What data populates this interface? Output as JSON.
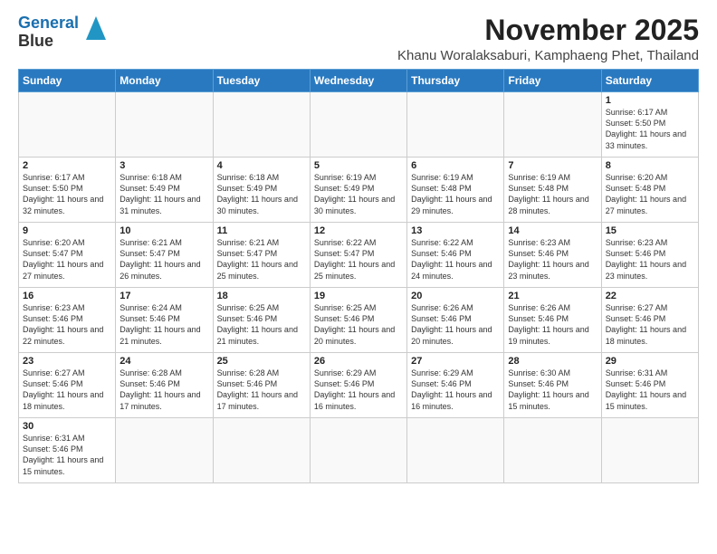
{
  "logo": {
    "line1": "General",
    "line2": "Blue"
  },
  "title": "November 2025",
  "location": "Khanu Woralaksaburi, Kamphaeng Phet, Thailand",
  "days_of_week": [
    "Sunday",
    "Monday",
    "Tuesday",
    "Wednesday",
    "Thursday",
    "Friday",
    "Saturday"
  ],
  "weeks": [
    [
      {
        "day": "",
        "info": ""
      },
      {
        "day": "",
        "info": ""
      },
      {
        "day": "",
        "info": ""
      },
      {
        "day": "",
        "info": ""
      },
      {
        "day": "",
        "info": ""
      },
      {
        "day": "",
        "info": ""
      },
      {
        "day": "1",
        "info": "Sunrise: 6:17 AM\nSunset: 5:50 PM\nDaylight: 11 hours\nand 33 minutes."
      }
    ],
    [
      {
        "day": "2",
        "info": "Sunrise: 6:17 AM\nSunset: 5:50 PM\nDaylight: 11 hours\nand 32 minutes."
      },
      {
        "day": "3",
        "info": "Sunrise: 6:18 AM\nSunset: 5:49 PM\nDaylight: 11 hours\nand 31 minutes."
      },
      {
        "day": "4",
        "info": "Sunrise: 6:18 AM\nSunset: 5:49 PM\nDaylight: 11 hours\nand 30 minutes."
      },
      {
        "day": "5",
        "info": "Sunrise: 6:19 AM\nSunset: 5:49 PM\nDaylight: 11 hours\nand 30 minutes."
      },
      {
        "day": "6",
        "info": "Sunrise: 6:19 AM\nSunset: 5:48 PM\nDaylight: 11 hours\nand 29 minutes."
      },
      {
        "day": "7",
        "info": "Sunrise: 6:19 AM\nSunset: 5:48 PM\nDaylight: 11 hours\nand 28 minutes."
      },
      {
        "day": "8",
        "info": "Sunrise: 6:20 AM\nSunset: 5:48 PM\nDaylight: 11 hours\nand 27 minutes."
      }
    ],
    [
      {
        "day": "9",
        "info": "Sunrise: 6:20 AM\nSunset: 5:47 PM\nDaylight: 11 hours\nand 27 minutes."
      },
      {
        "day": "10",
        "info": "Sunrise: 6:21 AM\nSunset: 5:47 PM\nDaylight: 11 hours\nand 26 minutes."
      },
      {
        "day": "11",
        "info": "Sunrise: 6:21 AM\nSunset: 5:47 PM\nDaylight: 11 hours\nand 25 minutes."
      },
      {
        "day": "12",
        "info": "Sunrise: 6:22 AM\nSunset: 5:47 PM\nDaylight: 11 hours\nand 25 minutes."
      },
      {
        "day": "13",
        "info": "Sunrise: 6:22 AM\nSunset: 5:46 PM\nDaylight: 11 hours\nand 24 minutes."
      },
      {
        "day": "14",
        "info": "Sunrise: 6:23 AM\nSunset: 5:46 PM\nDaylight: 11 hours\nand 23 minutes."
      },
      {
        "day": "15",
        "info": "Sunrise: 6:23 AM\nSunset: 5:46 PM\nDaylight: 11 hours\nand 23 minutes."
      }
    ],
    [
      {
        "day": "16",
        "info": "Sunrise: 6:23 AM\nSunset: 5:46 PM\nDaylight: 11 hours\nand 22 minutes."
      },
      {
        "day": "17",
        "info": "Sunrise: 6:24 AM\nSunset: 5:46 PM\nDaylight: 11 hours\nand 21 minutes."
      },
      {
        "day": "18",
        "info": "Sunrise: 6:25 AM\nSunset: 5:46 PM\nDaylight: 11 hours\nand 21 minutes."
      },
      {
        "day": "19",
        "info": "Sunrise: 6:25 AM\nSunset: 5:46 PM\nDaylight: 11 hours\nand 20 minutes."
      },
      {
        "day": "20",
        "info": "Sunrise: 6:26 AM\nSunset: 5:46 PM\nDaylight: 11 hours\nand 20 minutes."
      },
      {
        "day": "21",
        "info": "Sunrise: 6:26 AM\nSunset: 5:46 PM\nDaylight: 11 hours\nand 19 minutes."
      },
      {
        "day": "22",
        "info": "Sunrise: 6:27 AM\nSunset: 5:46 PM\nDaylight: 11 hours\nand 18 minutes."
      }
    ],
    [
      {
        "day": "23",
        "info": "Sunrise: 6:27 AM\nSunset: 5:46 PM\nDaylight: 11 hours\nand 18 minutes."
      },
      {
        "day": "24",
        "info": "Sunrise: 6:28 AM\nSunset: 5:46 PM\nDaylight: 11 hours\nand 17 minutes."
      },
      {
        "day": "25",
        "info": "Sunrise: 6:28 AM\nSunset: 5:46 PM\nDaylight: 11 hours\nand 17 minutes."
      },
      {
        "day": "26",
        "info": "Sunrise: 6:29 AM\nSunset: 5:46 PM\nDaylight: 11 hours\nand 16 minutes."
      },
      {
        "day": "27",
        "info": "Sunrise: 6:29 AM\nSunset: 5:46 PM\nDaylight: 11 hours\nand 16 minutes."
      },
      {
        "day": "28",
        "info": "Sunrise: 6:30 AM\nSunset: 5:46 PM\nDaylight: 11 hours\nand 15 minutes."
      },
      {
        "day": "29",
        "info": "Sunrise: 6:31 AM\nSunset: 5:46 PM\nDaylight: 11 hours\nand 15 minutes."
      }
    ],
    [
      {
        "day": "30",
        "info": "Sunrise: 6:31 AM\nSunset: 5:46 PM\nDaylight: 11 hours\nand 15 minutes."
      },
      {
        "day": "",
        "info": ""
      },
      {
        "day": "",
        "info": ""
      },
      {
        "day": "",
        "info": ""
      },
      {
        "day": "",
        "info": ""
      },
      {
        "day": "",
        "info": ""
      },
      {
        "day": "",
        "info": ""
      }
    ]
  ]
}
